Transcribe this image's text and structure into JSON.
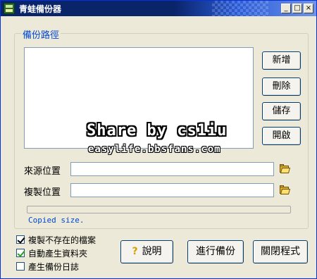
{
  "window": {
    "title": "青蛙備份器",
    "controls": {
      "minimize": "_",
      "maximize": "□",
      "close": "×"
    }
  },
  "backup_path": {
    "group_label": "備份路徑",
    "list_items": [],
    "buttons": {
      "add": "新增",
      "delete": "刪除",
      "save": "儲存",
      "open": "開啟"
    }
  },
  "source": {
    "label": "來源位置",
    "value": ""
  },
  "destination": {
    "label": "複製位置",
    "value": ""
  },
  "progress": {
    "value": 0,
    "status_text": "Copied size."
  },
  "options": [
    {
      "label": "複製不存在的檔案",
      "checked": true
    },
    {
      "label": "自動產生資料夾",
      "checked": true
    },
    {
      "label": "產生備份日誌",
      "checked": false
    }
  ],
  "actions": {
    "help": "說明",
    "help_icon": "?",
    "run": "進行備份",
    "close": "關閉程式"
  },
  "watermark": {
    "line1": "Share by cs1iu",
    "line2": "easylife.bbsfans.com"
  }
}
